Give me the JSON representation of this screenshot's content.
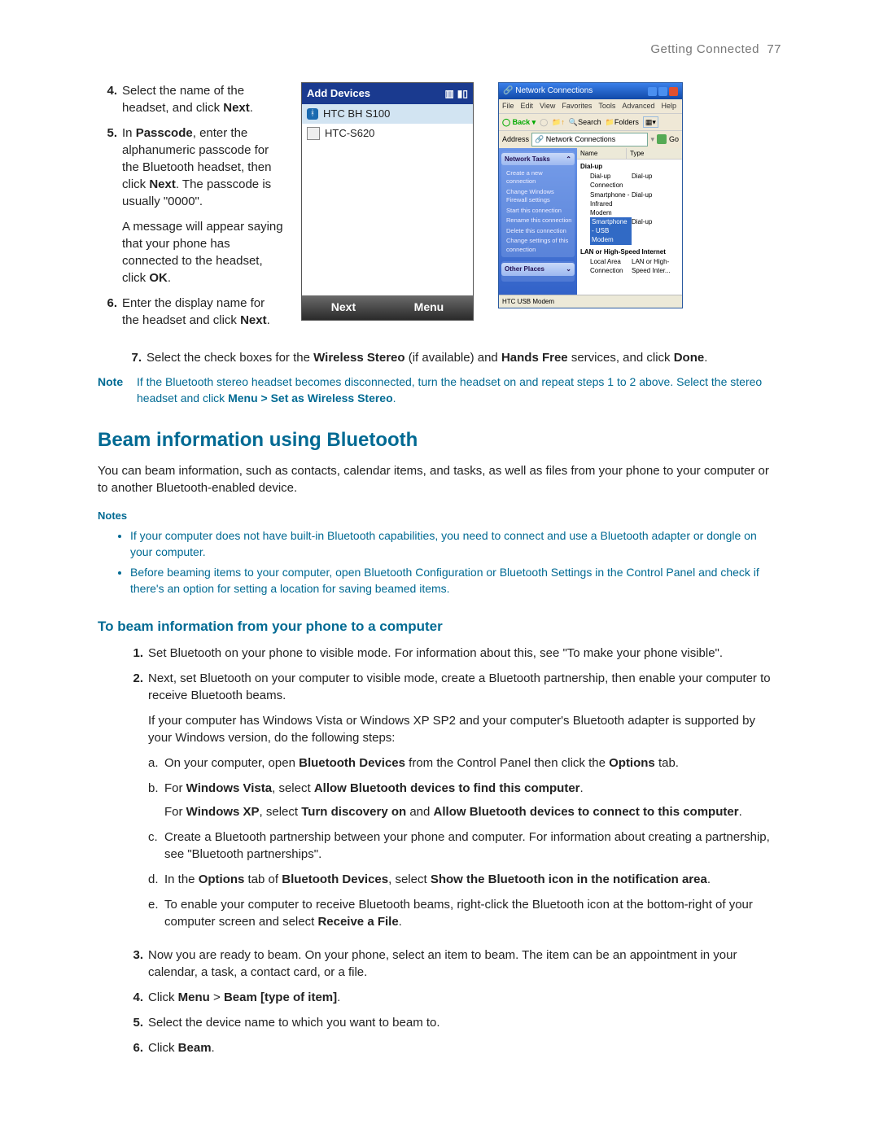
{
  "header": {
    "section": "Getting Connected",
    "page": "77"
  },
  "steps_top": {
    "s4": {
      "n": "4.",
      "t1": "Select the name of the headset, and click ",
      "b1": "Next",
      "t2": "."
    },
    "s5": {
      "n": "5.",
      "t1": "In ",
      "b1": "Passcode",
      "t2": ", enter the alphanumeric passcode for the Bluetooth headset, then click ",
      "b2": "Next",
      "t3": ". The passcode is usually \"0000\".",
      "sub1": "A message will appear saying that your phone has connected to the headset, click ",
      "sub_b": "OK",
      "sub2": "."
    },
    "s6": {
      "n": "6.",
      "t1": "Enter the display name for the headset and click ",
      "b1": "Next",
      "t2": "."
    }
  },
  "step7": {
    "n": "7.",
    "t1": "Select the check boxes for the ",
    "b1": "Wireless Stereo",
    "t2": " (if available) and ",
    "b2": "Hands Free",
    "t3": " services, and click ",
    "b3": "Done",
    "t4": "."
  },
  "note1": {
    "label": "Note",
    "t1": "If the Bluetooth stereo headset becomes disconnected, turn the headset on and repeat steps 1 to 2 above. Select the stereo headset and click ",
    "b1": "Menu > Set as Wireless Stereo",
    "t2": "."
  },
  "h2": "Beam information using Bluetooth",
  "intro": "You can beam information, such as contacts, calendar items, and tasks, as well as files from your phone to your computer or to another Bluetooth-enabled device.",
  "notes_label": "Notes",
  "notes": {
    "n1": "If your computer does not have built-in Bluetooth capabilities, you need to connect and use a Bluetooth adapter or dongle on your computer.",
    "n2": "Before beaming items to your computer, open Bluetooth Configuration or Bluetooth Settings in the Control Panel and check if there's an option for setting a location for saving beamed items."
  },
  "h3": "To beam information from your phone to a computer",
  "beam": {
    "s1": {
      "n": "1.",
      "t": "Set Bluetooth on your phone to visible mode. For information about this, see \"To make your phone visible\"."
    },
    "s2": {
      "n": "2.",
      "t": "Next, set Bluetooth on your computer to visible mode, create a Bluetooth partnership, then enable your computer to receive Bluetooth beams.",
      "sub": "If your computer has Windows Vista or Windows XP SP2 and your computer's Bluetooth adapter is supported by your Windows version, do the following steps:",
      "a": {
        "lt": "a.",
        "t1": "On your computer, open ",
        "b1": "Bluetooth Devices",
        "t2": " from the Control Panel then click the ",
        "b2": "Options",
        "t3": " tab."
      },
      "b": {
        "lt": "b.",
        "t1": "For ",
        "b1": "Windows Vista",
        "t2": ", select ",
        "b2": "Allow Bluetooth devices to find this computer",
        "t3": ".",
        "t4": "For ",
        "b3": "Windows XP",
        "t5": ", select ",
        "b4": "Turn discovery on",
        "t6": " and ",
        "b5": "Allow Bluetooth devices to connect to this computer",
        "t7": "."
      },
      "c": {
        "lt": "c.",
        "t": "Create a Bluetooth partnership between your phone and computer. For information about creating a partnership, see \"Bluetooth partnerships\"."
      },
      "d": {
        "lt": "d.",
        "t1": "In the ",
        "b1": "Options",
        "t2": " tab of ",
        "b2": "Bluetooth Devices",
        "t3": ", select ",
        "b3": "Show the Bluetooth icon in the notification area",
        "t4": "."
      },
      "e": {
        "lt": "e.",
        "t1": "To enable your computer to receive Bluetooth beams, right-click the Bluetooth icon at the bottom-right of your computer screen and select ",
        "b1": "Receive a File",
        "t2": "."
      }
    },
    "s3": {
      "n": "3.",
      "t": "Now you are ready to beam. On your phone, select an item to beam. The item can be an appointment in your calendar, a task, a contact card, or a file."
    },
    "s4": {
      "n": "4.",
      "t1": "Click ",
      "b1": "Menu",
      "t2": " > ",
      "b2": "Beam [type of item]",
      "t3": "."
    },
    "s5": {
      "n": "5.",
      "t": "Select the device name to which you want to beam to."
    },
    "s6": {
      "n": "6.",
      "t1": "Click ",
      "b1": "Beam",
      "t2": "."
    }
  },
  "phone": {
    "title": "Add Devices",
    "item1": "HTC BH S100",
    "item2": "HTC-S620",
    "btn_next": "Next",
    "btn_menu": "Menu"
  },
  "xp": {
    "title": "Network Connections",
    "menu": {
      "file": "File",
      "edit": "Edit",
      "view": "View",
      "fav": "Favorites",
      "tools": "Tools",
      "adv": "Advanced",
      "help": "Help"
    },
    "tool": {
      "back": "Back",
      "search": "Search",
      "folders": "Folders"
    },
    "addr_label": "Address",
    "addr_value": "Network Connections",
    "go": "Go",
    "side_hdr": "Network Tasks",
    "side": {
      "a": "Create a new connection",
      "b": "Change Windows Firewall settings",
      "c": "Start this connection",
      "d": "Rename this connection",
      "e": "Delete this connection",
      "f": "Change settings of this connection"
    },
    "side_hdr2": "Other Places",
    "col_name": "Name",
    "col_type": "Type",
    "grp1": "Dial-up",
    "r1": {
      "n": "Dial-up Connection",
      "t": "Dial-up"
    },
    "r2": {
      "n": "Smartphone - Infrared Modem",
      "t": "Dial-up"
    },
    "r3": {
      "n": "Smartphone - USB Modem",
      "t": "Dial-up"
    },
    "grp2": "LAN or High-Speed Internet",
    "r4": {
      "n": "Local Area Connection",
      "t": "LAN or High-Speed Inter..."
    },
    "status": "HTC USB Modem"
  }
}
